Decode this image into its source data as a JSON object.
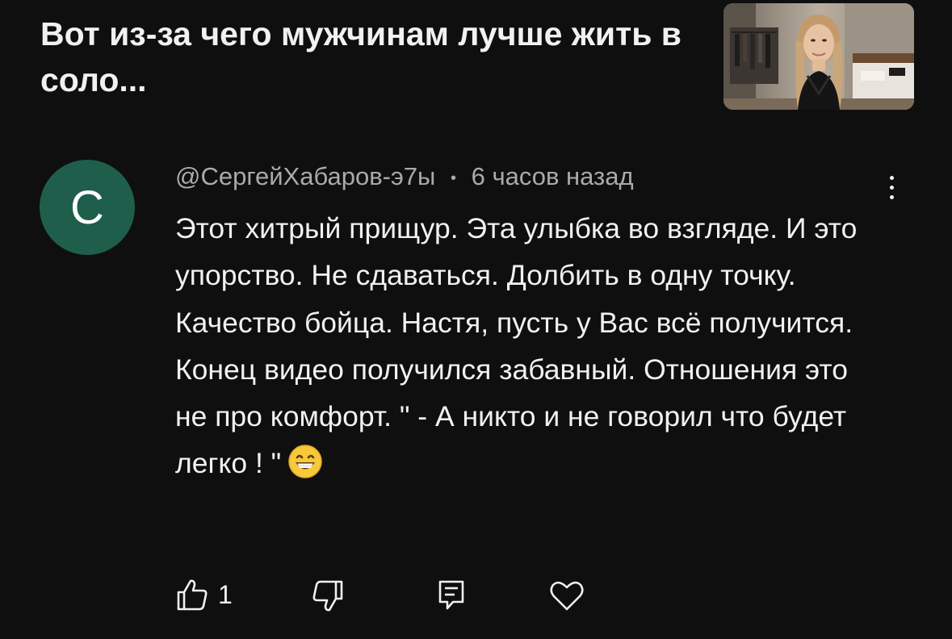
{
  "video": {
    "title": "Вот из-за чего мужчинам лучше жить в соло..."
  },
  "comment": {
    "avatar_letter": "С",
    "author": "@СергейХабаров-э7ы",
    "separator": "•",
    "time": "6 часов назад",
    "text": "Этот хитрый прищур. Эта улыбка во взгляде. И это упорство. Не сдаваться. Долбить в одну точку. Качество бойца. Настя, пусть у Вас всё получится. Конец видео получился забавный. Отношения это не про комфорт. \" - А никто и не говорил что будет легко ! \"",
    "emoji": "grinning-face-emoji",
    "like_count": "1"
  },
  "icons": {
    "like": "thumbs-up-icon",
    "dislike": "thumbs-down-icon",
    "reply": "reply-comment-icon",
    "heart": "heart-icon",
    "more": "more-vert-icon"
  },
  "colors": {
    "background": "#0f0f0f",
    "avatar": "#1f5e4a",
    "text_primary": "#f1f1f1",
    "text_secondary": "#aaaaaa",
    "emoji_face": "#f7c83a"
  }
}
